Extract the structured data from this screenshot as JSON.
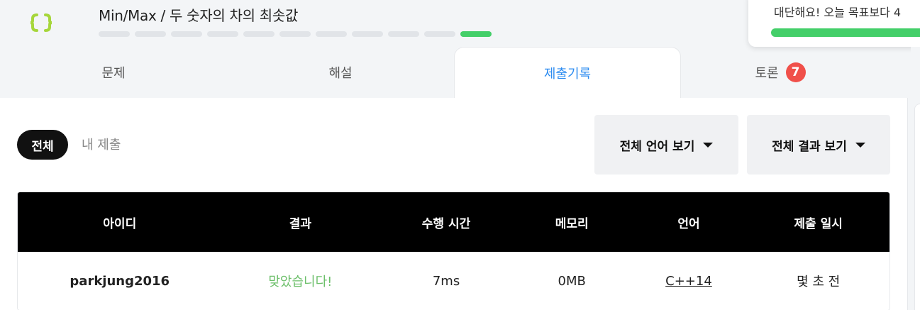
{
  "header": {
    "title": "Min/Max / 두 숫자의 차의 최솟값",
    "progress": {
      "total_steps": 11,
      "completed_steps": 1,
      "current_step": 11
    },
    "goal_text": "대단해요! 오늘 목표보다 4",
    "goal_progress": 1.0
  },
  "tabs": [
    {
      "label": "문제"
    },
    {
      "label": "해설"
    },
    {
      "label": "제출기록",
      "active": true
    },
    {
      "label": "토론",
      "badge": "7"
    }
  ],
  "filters": {
    "all_label": "전체",
    "mine_label": "내 제출",
    "language_dropdown": "전체 언어 보기",
    "result_dropdown": "전체 결과 보기"
  },
  "table": {
    "headers": [
      "아이디",
      "결과",
      "수행 시간",
      "메모리",
      "언어",
      "제출 일시"
    ],
    "rows": [
      {
        "user": "parkjung2016",
        "result": "맞았습니다!",
        "time": "7ms",
        "memory": "0MB",
        "language": "C++14",
        "submitted": "몇 초 전"
      }
    ]
  },
  "colors": {
    "accent": "#2d8cf0",
    "success": "#44cf69",
    "result_ok": "#6cbf6a",
    "badge": "#f0504a",
    "logo": "#a6d63b"
  },
  "icons": {
    "logo": "braces-logo-icon",
    "caret": "caret-down-icon"
  }
}
